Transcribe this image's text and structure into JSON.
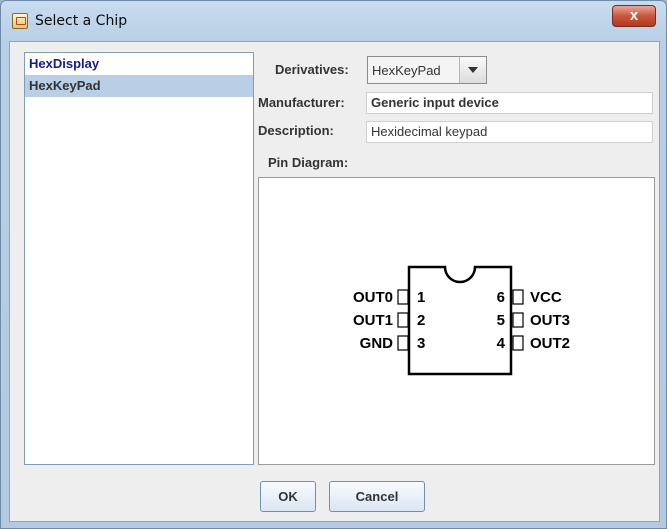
{
  "window": {
    "title": "Select a Chip",
    "close_glyph": "x"
  },
  "chip_list": {
    "items": [
      {
        "label": "HexDisplay",
        "selected": false
      },
      {
        "label": "HexKeyPad",
        "selected": true
      }
    ]
  },
  "form": {
    "derivatives_label": "Derivatives:",
    "derivatives_value": "HexKeyPad",
    "manufacturer_label": "Manufacturer:",
    "manufacturer_value": "Generic input device",
    "description_label": "Description:",
    "description_value": "Hexidecimal keypad",
    "pin_diagram_label": "Pin Diagram:"
  },
  "pin_diagram": {
    "left_pins": [
      {
        "name": "OUT0",
        "number": "1"
      },
      {
        "name": "OUT1",
        "number": "2"
      },
      {
        "name": "GND",
        "number": "3"
      }
    ],
    "right_pins": [
      {
        "name": "VCC",
        "number": "6"
      },
      {
        "name": "OUT3",
        "number": "5"
      },
      {
        "name": "OUT2",
        "number": "4"
      }
    ]
  },
  "buttons": {
    "ok": "OK",
    "cancel": "Cancel"
  }
}
